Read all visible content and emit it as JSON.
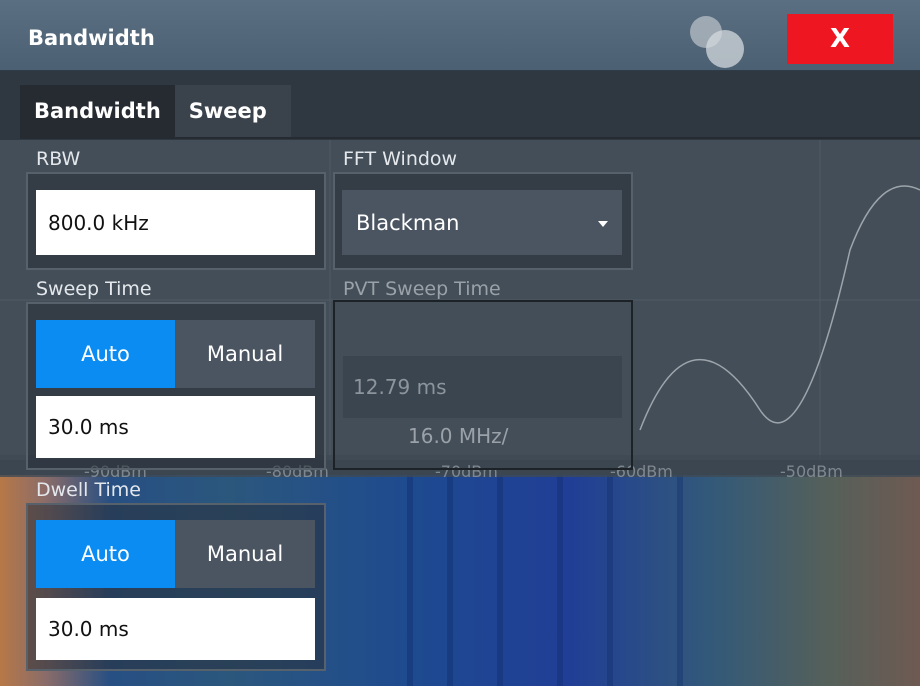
{
  "dialog": {
    "title": "Bandwidth",
    "close_label": "X"
  },
  "tabs": [
    {
      "label": "Bandwidth",
      "active": true
    },
    {
      "label": "Sweep",
      "active": false
    }
  ],
  "rbw": {
    "label": "RBW",
    "value": "800.0 kHz"
  },
  "fft_window": {
    "label": "FFT Window",
    "selected": "Blackman"
  },
  "sweep_time": {
    "label": "Sweep Time",
    "options": [
      "Auto",
      "Manual"
    ],
    "selected": "Auto",
    "value": "30.0 ms"
  },
  "pvt_sweep_time": {
    "label": "PVT Sweep Time",
    "value": "12.79 ms"
  },
  "dwell_time": {
    "label": "Dwell Time",
    "options": [
      "Auto",
      "Manual"
    ],
    "selected": "Auto",
    "value": "30.0 ms"
  },
  "background": {
    "center_label": "16.0 MHz/",
    "scale_labels": [
      "-90dBm",
      "-80dBm",
      "-70dBm",
      "-60dBm",
      "-50dBm"
    ]
  },
  "colors": {
    "accent": "#0a8cf2",
    "close": "#ee1620",
    "title_bar": "#51667a"
  }
}
